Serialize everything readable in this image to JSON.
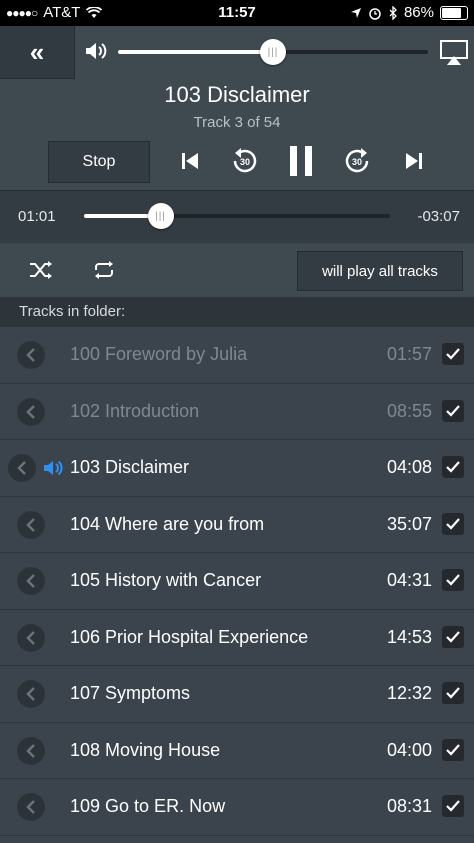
{
  "status": {
    "carrier": "AT&T",
    "time": "11:57",
    "battery": "86%",
    "battery_level": 0.86
  },
  "player": {
    "back_label": "«",
    "volume_level": 0.5,
    "title": "103 Disclaimer",
    "subtitle": "Track 3 of 54",
    "stop_label": "Stop",
    "skip_back_label": "30",
    "skip_forward_label": "30",
    "elapsed": "01:01",
    "remaining": "-03:07",
    "progress": 0.25,
    "play_all_label": "will play all tracks"
  },
  "list": {
    "header": "Tracks in folder:",
    "tracks": [
      {
        "name": "100 Foreword by Julia",
        "duration": "01:57",
        "state": "played"
      },
      {
        "name": "102 Introduction",
        "duration": "08:55",
        "state": "played"
      },
      {
        "name": "103 Disclaimer",
        "duration": "04:08",
        "state": "current"
      },
      {
        "name": "104 Where are you from",
        "duration": "35:07",
        "state": "normal"
      },
      {
        "name": "105 History with Cancer",
        "duration": "04:31",
        "state": "normal"
      },
      {
        "name": "106 Prior Hospital Experience",
        "duration": "14:53",
        "state": "normal"
      },
      {
        "name": "107 Symptoms",
        "duration": "12:32",
        "state": "normal"
      },
      {
        "name": "108 Moving House",
        "duration": "04:00",
        "state": "normal"
      },
      {
        "name": "109 Go to ER. Now",
        "duration": "08:31",
        "state": "normal"
      }
    ]
  },
  "colors": {
    "accent_blue": "#2e8ff5",
    "background": "#3b444c"
  }
}
